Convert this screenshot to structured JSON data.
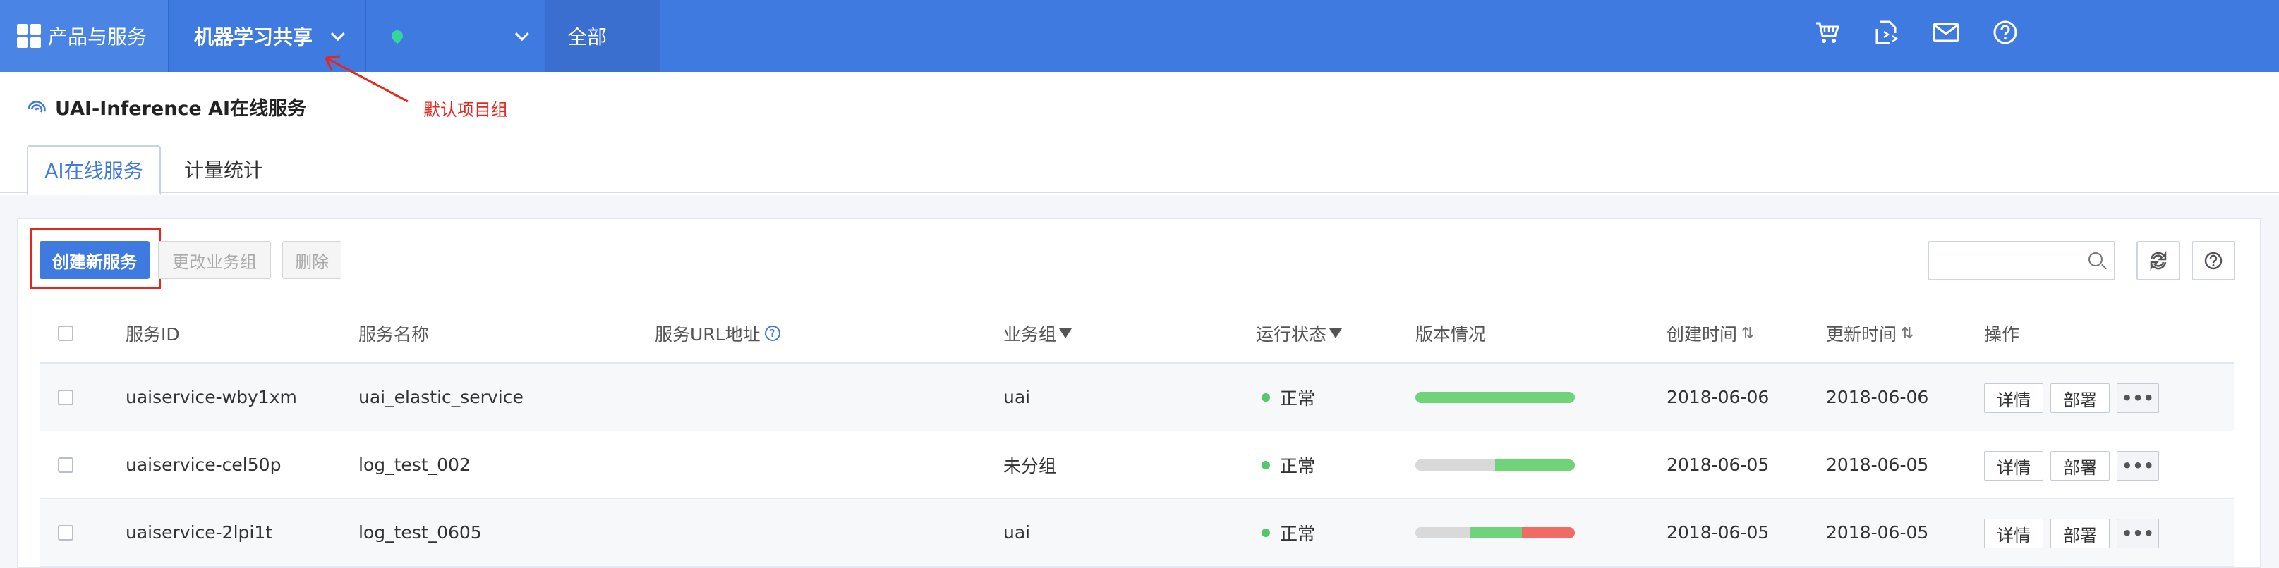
{
  "topbar": {
    "products_label": "产品与服务",
    "project_label": "机器学习共享",
    "region_label": "",
    "all_label": "全部",
    "icons": [
      "cart-icon",
      "transfer-icon",
      "mail-icon",
      "help-icon"
    ],
    "color": "#3f7ae0"
  },
  "page": {
    "title": "UAI-Inference AI在线服务",
    "annotation": "默认项目组"
  },
  "tabs": [
    {
      "label": "AI在线服务",
      "active": true
    },
    {
      "label": "计量统计",
      "active": false
    }
  ],
  "toolbar": {
    "create_label": "创建新服务",
    "change_group_label": "更改业务组",
    "delete_label": "删除",
    "search_placeholder": ""
  },
  "table": {
    "columns": {
      "id": "服务ID",
      "name": "服务名称",
      "url": "服务URL地址",
      "group": "业务组",
      "status": "运行状态",
      "version": "版本情况",
      "created": "创建时间",
      "updated": "更新时间",
      "actions": "操作"
    },
    "rows": [
      {
        "id": "uaiservice-wby1xm",
        "name": "uai_elastic_service",
        "url": "",
        "group": "uai",
        "status": "正常",
        "created": "2018-06-06",
        "updated": "2018-06-06",
        "version": [
          {
            "frac": 1.0,
            "color": "#6fd37a"
          }
        ]
      },
      {
        "id": "uaiservice-cel50p",
        "name": "log_test_002",
        "url": "",
        "group": "未分组",
        "status": "正常",
        "created": "2018-06-05",
        "updated": "2018-06-05",
        "version": [
          {
            "frac": 0.5,
            "color": "#d9d9d9"
          },
          {
            "frac": 0.5,
            "color": "#6fd37a"
          }
        ]
      },
      {
        "id": "uaiservice-2lpi1t",
        "name": "log_test_0605",
        "url": "",
        "group": "uai",
        "status": "正常",
        "created": "2018-06-05",
        "updated": "2018-06-05",
        "version": [
          {
            "frac": 0.34,
            "color": "#d9d9d9"
          },
          {
            "frac": 0.33,
            "color": "#6fd37a"
          },
          {
            "frac": 0.33,
            "color": "#f06b63"
          }
        ]
      }
    ],
    "action_labels": {
      "detail": "详情",
      "deploy": "部署",
      "more": "•••"
    }
  }
}
